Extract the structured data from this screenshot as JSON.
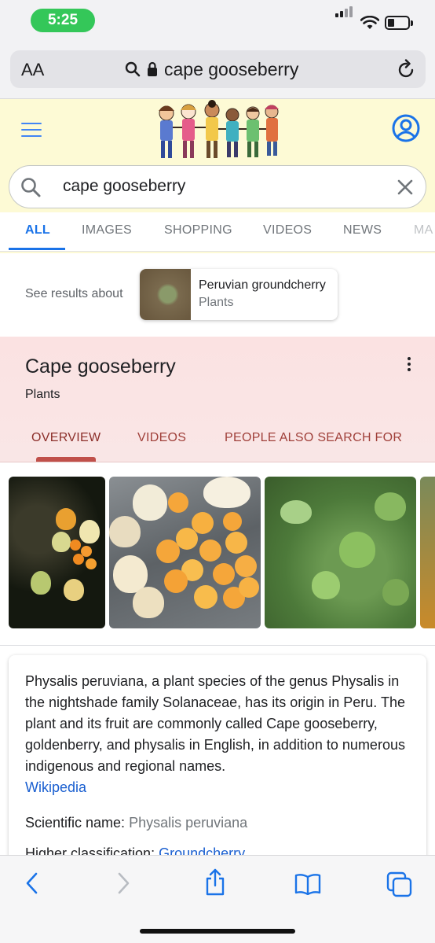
{
  "status_bar": {
    "time": "5:25"
  },
  "browser": {
    "aa_label": "AA",
    "url_text": "cape gooseberry",
    "icons": [
      "search-icon",
      "lock-icon",
      "reload-icon"
    ]
  },
  "google": {
    "search_query": "cape gooseberry",
    "tabs": [
      "ALL",
      "IMAGES",
      "SHOPPING",
      "VIDEOS",
      "NEWS",
      "MA"
    ],
    "active_tab": "ALL"
  },
  "see_results": {
    "label": "See results about",
    "card_title": "Peruvian groundcherry",
    "card_subtitle": "Plants"
  },
  "knowledge_panel": {
    "title": "Cape gooseberry",
    "subtitle": "Plants",
    "tabs": [
      "OVERVIEW",
      "VIDEOS",
      "PEOPLE ALSO SEARCH FOR"
    ],
    "active_tab": "OVERVIEW"
  },
  "description": {
    "text": "Physalis peruviana, a plant species of the genus Physalis in the nightshade family Solanaceae, has its origin in Peru. The plant and its fruit are commonly called Cape gooseberry, goldenberry, and physalis in English, in addition to numerous indigenous and regional names.",
    "source_link": "Wikipedia",
    "scientific_label": "Scientific name:",
    "scientific_value": "Physalis peruviana",
    "higher_label": "Higher classification:",
    "higher_value": "Groundcherry"
  },
  "colors": {
    "google_blue": "#1a73e8",
    "panel_accent": "#c0504a",
    "status_green": "#34c759"
  }
}
